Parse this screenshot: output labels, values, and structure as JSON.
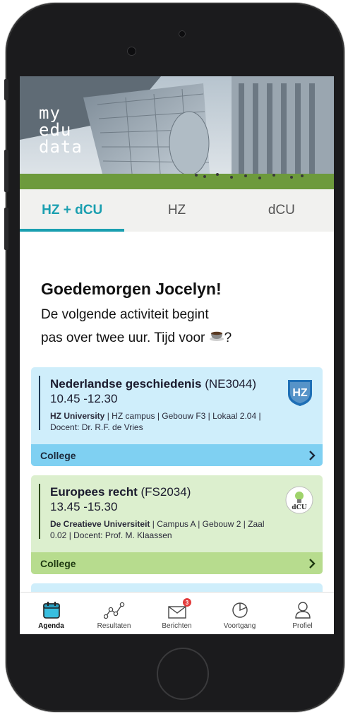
{
  "app": {
    "logo_lines": [
      "my",
      "edu",
      "data"
    ]
  },
  "tabs": [
    {
      "label": "HZ + dCU",
      "active": true
    },
    {
      "label": "HZ",
      "active": false
    },
    {
      "label": "dCU",
      "active": false
    }
  ],
  "greeting": {
    "title": "Goedemorgen Jocelyn!",
    "line1": "De volgende activiteit begint",
    "line2": "pas over twee uur. Tijd voor",
    "line2_end": "?"
  },
  "cards": [
    {
      "course": "Nederlandse geschiedenis",
      "code": "(NE3044)",
      "time": "10.45 -12.30",
      "institution": "HZ University",
      "details": "| HZ campus | Gebouw F3 | Lokaal 2.04 |  Docent: Dr. R.F. de Vries",
      "type": "College",
      "badge": "HZ",
      "color": "#cfeefb"
    },
    {
      "course": "Europees recht",
      "code": "(FS2034)",
      "time": "13.45 -15.30",
      "institution": "De Creatieve Universiteit",
      "details": "| Campus A | Gebouw 2 | Zaal 0.02 | Docent: Prof. M. Klaassen",
      "type": "College",
      "badge": "dCU",
      "color": "#dcefce"
    }
  ],
  "bottom_nav": [
    {
      "label": "Agenda",
      "icon": "calendar-icon",
      "active": true
    },
    {
      "label": "Resultaten",
      "icon": "chart-line-icon",
      "active": false
    },
    {
      "label": "Berichten",
      "icon": "mail-icon",
      "active": false,
      "badge": "3"
    },
    {
      "label": "Voortgang",
      "icon": "pie-chart-icon",
      "active": false
    },
    {
      "label": "Profiel",
      "icon": "person-icon",
      "active": false
    }
  ],
  "colors": {
    "accent": "#1a9fb0",
    "hz_card": "#cfeefb",
    "hz_footer": "#7fd0f2",
    "dcu_card": "#dcefce",
    "dcu_footer": "#b7dc8e"
  }
}
